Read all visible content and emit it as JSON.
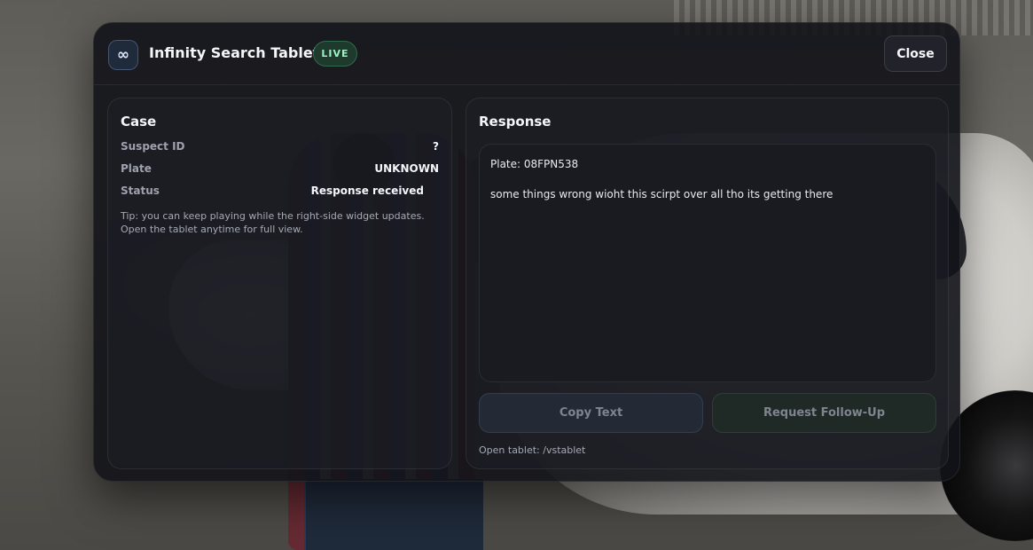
{
  "header": {
    "logo_glyph": "∞",
    "title": "Infinity Search Tablet",
    "badge": "LIVE",
    "close_label": "Close"
  },
  "case": {
    "title": "Case",
    "fields": [
      {
        "label": "Suspect ID",
        "value": "?"
      },
      {
        "label": "Plate",
        "value": "UNKNOWN"
      },
      {
        "label": "Status",
        "value": "Response received"
      }
    ],
    "tip": "Tip: you can keep playing while the right-side widget updates. Open the tablet anytime for full view."
  },
  "response": {
    "title": "Response",
    "plate_line": "Plate: 08FPN538",
    "message": "some things wrong wioht this scirpt over all tho its getting there",
    "copy_label": "Copy Text",
    "followup_label": "Request Follow-Up",
    "hint": "Open tablet: /vstablet"
  },
  "colors": {
    "live_badge_bg": "#1d3a2d",
    "live_badge_text": "#9ff0c4",
    "panel_bg": "#121318"
  }
}
